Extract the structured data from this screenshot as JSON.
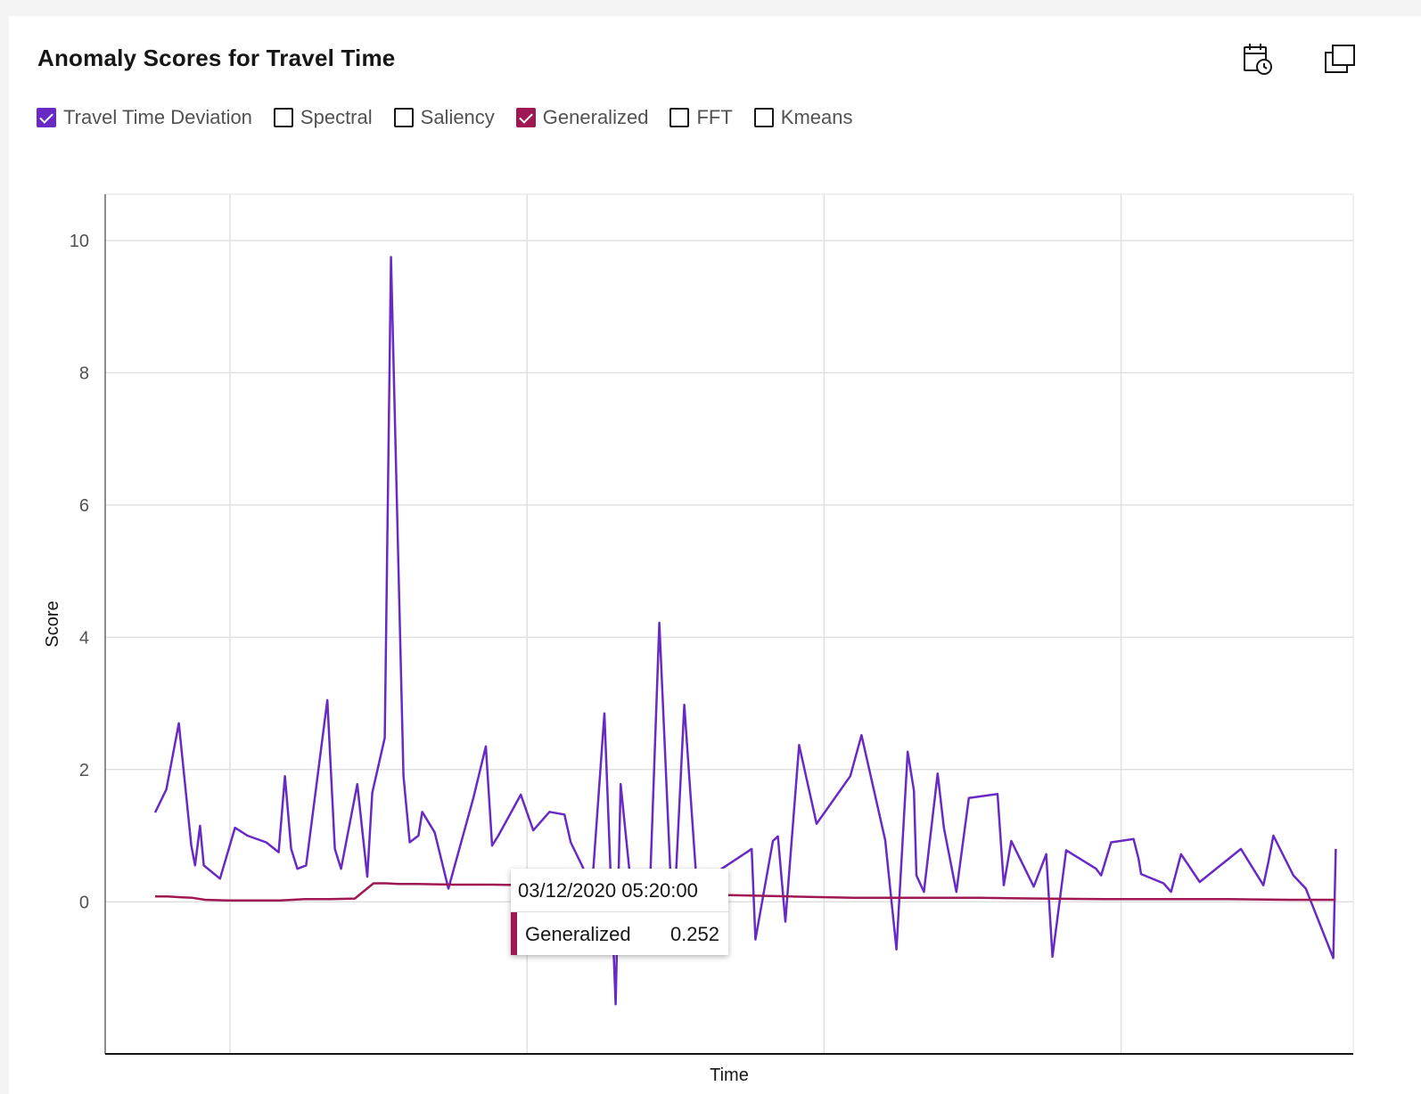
{
  "header": {
    "title": "Anomaly Scores for Travel Time"
  },
  "toolbar": {
    "calendar_icon": "calendar-clock-icon",
    "expand_icon": "maximize-icon"
  },
  "legend": {
    "items": [
      {
        "label": "Travel Time Deviation",
        "checked": true,
        "color": "#6929c4"
      },
      {
        "label": "Spectral",
        "checked": false,
        "color": "#1192e8"
      },
      {
        "label": "Saliency",
        "checked": false,
        "color": "#005d5d"
      },
      {
        "label": "Generalized",
        "checked": true,
        "color": "#9f1853"
      },
      {
        "label": "FFT",
        "checked": false,
        "color": "#fa4d56"
      },
      {
        "label": "Kmeans",
        "checked": false,
        "color": "#570408"
      }
    ]
  },
  "tooltip": {
    "date": "03/12/2020 05:20:00",
    "series": "Generalized",
    "value": "0.252",
    "color": "#9f1853"
  },
  "chart_data": {
    "type": "line",
    "title": "Anomaly Scores for Travel Time",
    "xlabel": "Time",
    "ylabel": "Score",
    "ylim": [
      -2.3,
      10.7
    ],
    "xlim": [
      0,
      100
    ],
    "yticks": [
      0,
      2,
      4,
      6,
      8,
      10
    ],
    "grid": true,
    "legend_position": "top-left",
    "series": [
      {
        "name": "Travel Time Deviation",
        "color": "#6929c4",
        "x": [
          4.0,
          4.9,
          5.9,
          6.9,
          7.2,
          7.6,
          7.9,
          9.2,
          10.4,
          11.4,
          12.9,
          13.9,
          14.4,
          14.9,
          15.4,
          16.1,
          17.8,
          18.4,
          18.9,
          20.2,
          21.0,
          21.4,
          22.4,
          22.9,
          23.9,
          24.4,
          25.1,
          25.4,
          26.4,
          27.5,
          29.5,
          30.5,
          31.0,
          31.5,
          33.3,
          34.3,
          35.6,
          36.8,
          37.3,
          38.2,
          39.0,
          40.0,
          40.9,
          41.3,
          42.5,
          43.7,
          44.4,
          45.5,
          46.4,
          47.4,
          51.8,
          52.1,
          53.5,
          53.9,
          54.5,
          55.6,
          57.0,
          59.7,
          60.6,
          62.5,
          63.4,
          64.3,
          64.8,
          65.0,
          65.6,
          66.7,
          67.2,
          68.2,
          69.2,
          71.5,
          72.0,
          72.6,
          74.4,
          75.4,
          75.9,
          77.0,
          79.4,
          79.8,
          80.6,
          82.4,
          82.8,
          83.0,
          84.8,
          85.4,
          86.2,
          87.7,
          91.0,
          92.8,
          93.2,
          93.6,
          95.2,
          96.2,
          98.4,
          98.6
        ],
        "y": [
          1.35,
          1.7,
          2.7,
          0.85,
          0.55,
          1.15,
          0.55,
          0.35,
          1.12,
          1.0,
          0.9,
          0.75,
          1.9,
          0.8,
          0.5,
          0.55,
          3.05,
          0.8,
          0.5,
          1.78,
          0.38,
          1.65,
          2.48,
          9.75,
          1.9,
          0.9,
          1.0,
          1.36,
          1.05,
          0.2,
          1.57,
          2.35,
          0.85,
          1.0,
          1.62,
          1.08,
          1.36,
          1.32,
          0.9,
          0.55,
          0.2,
          2.85,
          -1.55,
          1.78,
          -0.45,
          0.5,
          4.22,
          -0.48,
          2.98,
          0.25,
          0.8,
          -0.57,
          0.92,
          0.99,
          -0.3,
          2.37,
          1.18,
          1.9,
          2.52,
          0.93,
          -0.72,
          2.27,
          1.68,
          0.4,
          0.15,
          1.94,
          1.12,
          0.15,
          1.57,
          1.63,
          0.25,
          0.92,
          0.23,
          0.72,
          -0.83,
          0.78,
          0.5,
          0.4,
          0.9,
          0.95,
          0.65,
          0.42,
          0.28,
          0.15,
          0.72,
          0.3,
          0.8,
          0.25,
          0.6,
          1.0,
          0.4,
          0.2,
          -0.85,
          0.8
        ],
        "note_x_order": "Travel Time Deviation x values paired index-wise with y values"
      },
      {
        "name": "Generalized",
        "color": "#9f1853",
        "x": [
          4,
          5,
          6,
          7,
          8,
          10,
          12,
          14,
          16,
          18,
          20,
          21.5,
          22.5,
          23.5,
          25,
          28,
          31,
          34,
          37,
          40,
          43,
          46,
          50,
          55,
          60,
          65,
          70,
          75,
          80,
          85,
          90,
          95,
          98.6
        ],
        "y": [
          0.08,
          0.08,
          0.07,
          0.06,
          0.03,
          0.02,
          0.02,
          0.02,
          0.04,
          0.04,
          0.05,
          0.28,
          0.28,
          0.27,
          0.27,
          0.26,
          0.26,
          0.252,
          0.1,
          0.1,
          0.1,
          0.12,
          0.1,
          0.08,
          0.06,
          0.06,
          0.06,
          0.05,
          0.04,
          0.04,
          0.04,
          0.03,
          0.03
        ]
      }
    ]
  }
}
